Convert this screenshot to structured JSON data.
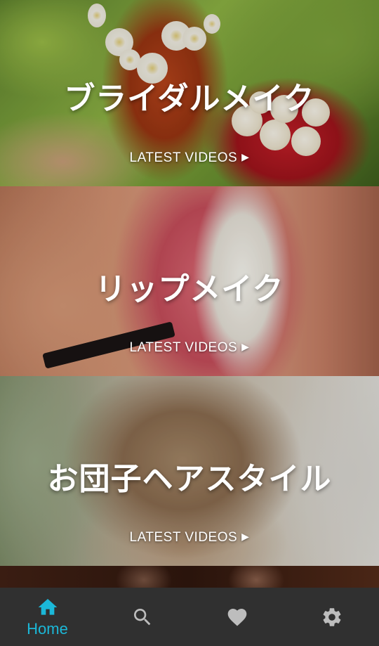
{
  "feed": {
    "cards": [
      {
        "title": "ブライダルメイク",
        "cta": "LATEST VIDEOS",
        "image": "bride-with-flower-hair-and-rose-bouquet"
      },
      {
        "title": "リップメイク",
        "cta": "LATEST VIDEOS",
        "image": "lips-with-lip-brush"
      },
      {
        "title": "お団子ヘアスタイル",
        "cta": "LATEST VIDEOS",
        "image": "braided-bun-hairstyle"
      },
      {
        "title": "",
        "cta": "",
        "image": "two-women-portrait"
      }
    ],
    "cta_arrow": "▶"
  },
  "bottom_nav": {
    "active_color": "#1bb8d8",
    "inactive_color": "#bdbdbd",
    "background": "#303030",
    "items": [
      {
        "icon": "home-icon",
        "label": "Home",
        "active": true
      },
      {
        "icon": "search-icon",
        "label": "",
        "active": false
      },
      {
        "icon": "heart-icon",
        "label": "",
        "active": false
      },
      {
        "icon": "gear-icon",
        "label": "",
        "active": false
      }
    ]
  }
}
